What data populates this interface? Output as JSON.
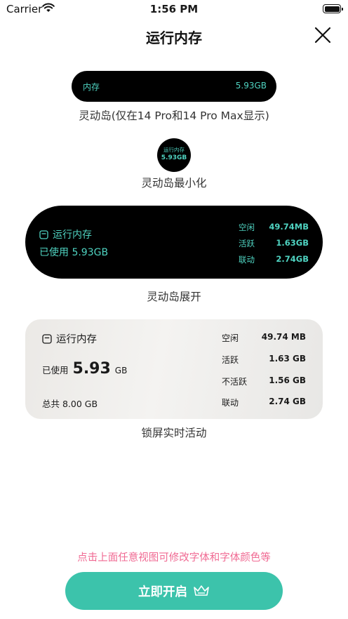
{
  "status_bar": {
    "carrier": "Carrier",
    "time": "1:56 PM"
  },
  "header": {
    "title": "运行内存"
  },
  "pill": {
    "label": "内存",
    "value": "5.93GB",
    "caption": "灵动岛(仅在14 Pro和14 Pro Max显示)"
  },
  "mini": {
    "line1": "运行内存",
    "line2": "5.93GB",
    "caption": "灵动岛最小化"
  },
  "expanded": {
    "title": "运行内存",
    "used": "已使用 5.93GB",
    "stats": [
      {
        "key": "空闲",
        "value": "49.74MB"
      },
      {
        "key": "活跃",
        "value": "1.63GB"
      },
      {
        "key": "联动",
        "value": "2.74GB"
      }
    ],
    "caption": "灵动岛展开"
  },
  "lock": {
    "title": "运行内存",
    "used_label": "已使用",
    "used_value": "5.93",
    "used_unit": "GB",
    "total": "总共 8.00 GB",
    "stats": [
      {
        "key": "空闲",
        "value": "49.74 MB"
      },
      {
        "key": "活跃",
        "value": "1.63 GB"
      },
      {
        "key": "不活跃",
        "value": "1.56 GB"
      },
      {
        "key": "联动",
        "value": "2.74 GB"
      }
    ],
    "caption": "锁屏实时活动"
  },
  "hint": "点击上面任意视图可修改字体和字体颜色等",
  "start_button": {
    "label": "立即开启"
  },
  "colors": {
    "accent": "#4fd3c1",
    "button": "#3cc3ab",
    "hint": "#f06a93"
  }
}
